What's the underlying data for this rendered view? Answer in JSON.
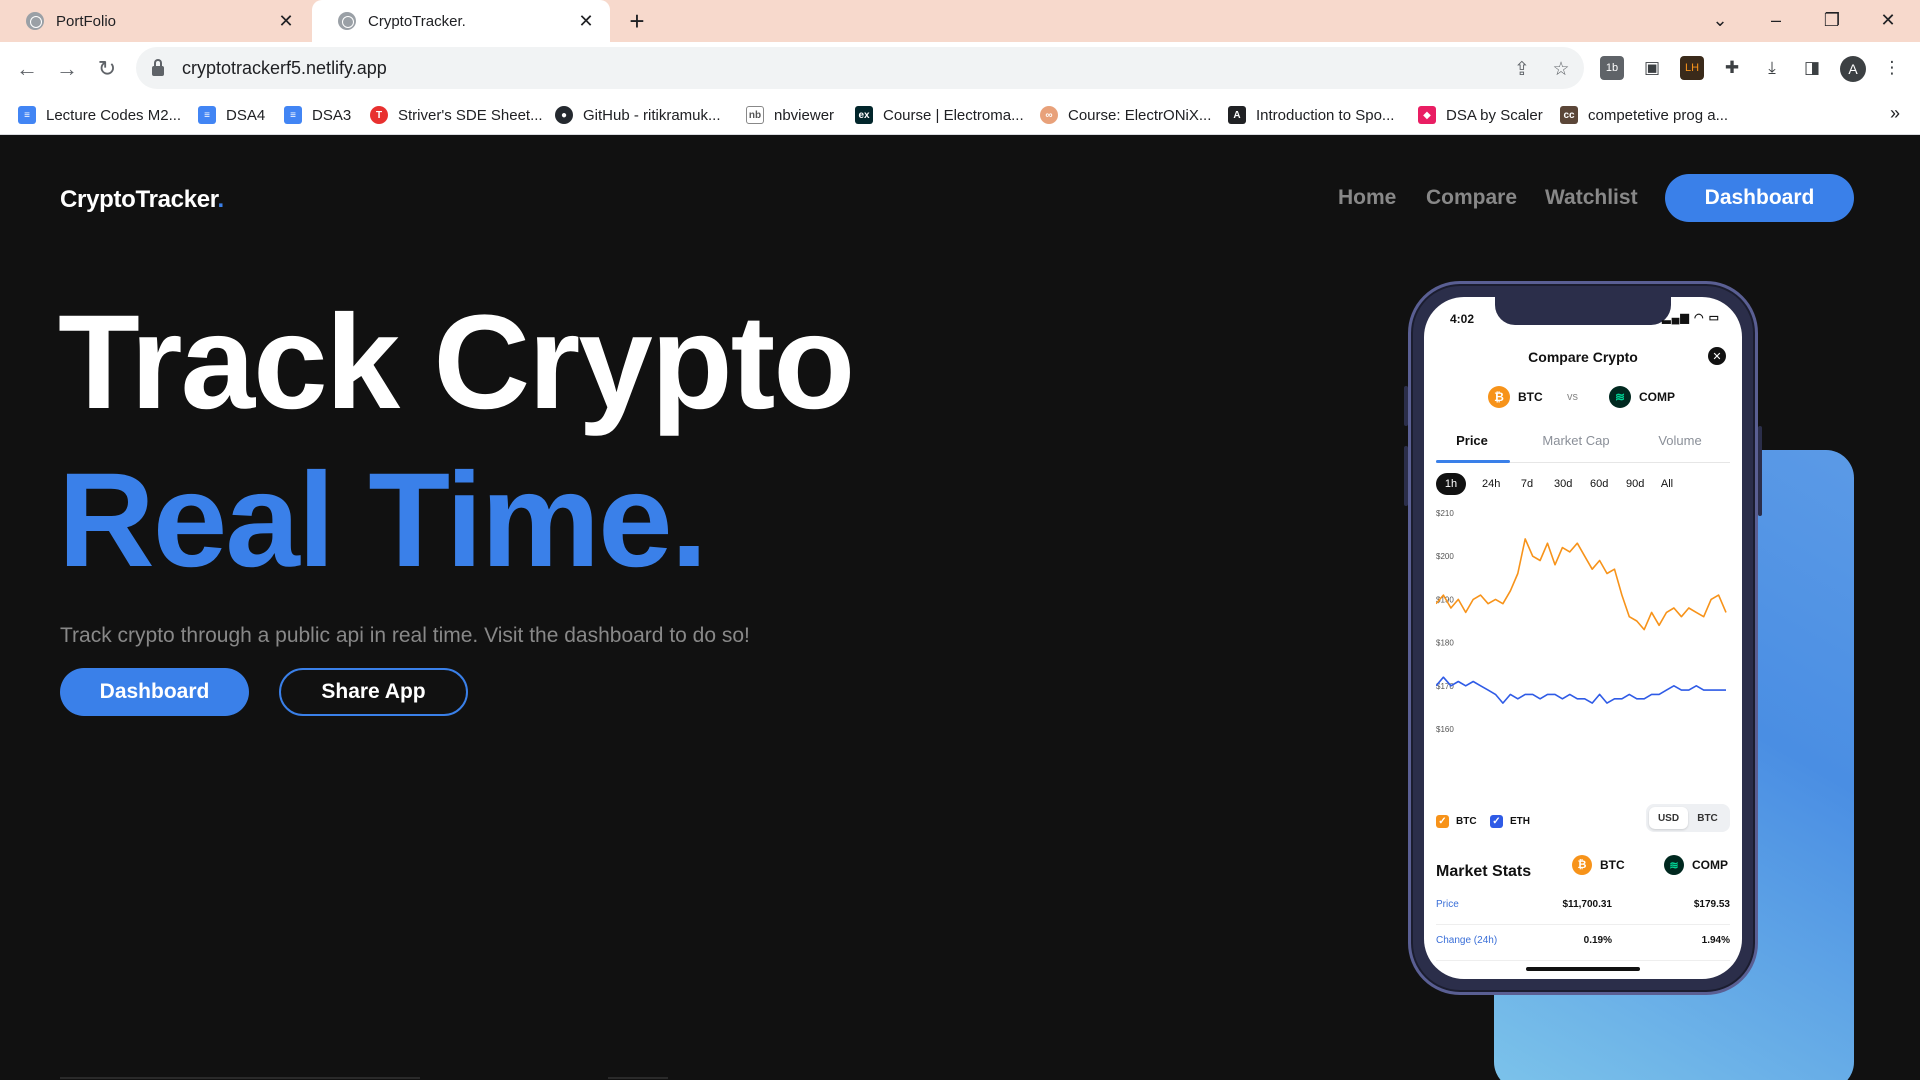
{
  "browser": {
    "tabs": [
      {
        "title": "PortFolio",
        "active": false
      },
      {
        "title": "CryptoTracker.",
        "active": true
      }
    ],
    "url": "cryptotrackerf5.netlify.app",
    "profile_initial": "A",
    "bookmarks": [
      {
        "label": "Lecture Codes M2...",
        "icon": "doc-icon",
        "color": "#4285f4"
      },
      {
        "label": "DSA4",
        "icon": "doc-icon",
        "color": "#4285f4"
      },
      {
        "label": "DSA3",
        "icon": "doc-icon",
        "color": "#4285f4"
      },
      {
        "label": "Striver's SDE Sheet...",
        "icon": "tuf-icon",
        "color": "#e8302f"
      },
      {
        "label": "GitHub - ritikramuk...",
        "icon": "github-icon",
        "color": "#24292f"
      },
      {
        "label": "nbviewer",
        "icon": "nbviewer-icon",
        "color": "#f37726"
      },
      {
        "label": "Course | Electroma...",
        "icon": "edx-icon",
        "color": "#02262b"
      },
      {
        "label": "Course: ElectrONiX...",
        "icon": "course-icon",
        "color": "#e8a17a"
      },
      {
        "label": "Introduction to Spo...",
        "icon": "translate-icon",
        "color": "#202124"
      },
      {
        "label": "DSA by Scaler",
        "icon": "scaler-icon",
        "color": "#e91e63"
      },
      {
        "label": "competetive prog a...",
        "icon": "cc-icon",
        "color": "#5b4638"
      }
    ]
  },
  "site": {
    "logo": "CryptoTracker",
    "logo_dot": ".",
    "nav": [
      "Home",
      "Compare",
      "Watchlist"
    ],
    "nav_cta": "Dashboard",
    "hero_line1": "Track Crypto",
    "hero_line2": "Real Time.",
    "subtitle": "Track crypto through a public api in real time. Visit the dashboard to do so!",
    "cta_primary": "Dashboard",
    "cta_secondary": "Share App",
    "accent": "#3a80e9"
  },
  "phone": {
    "time": "4:02",
    "title": "Compare Crypto",
    "coin_a": "BTC",
    "vs": "vs",
    "coin_b": "COMP",
    "tabs": [
      "Price",
      "Market Cap",
      "Volume"
    ],
    "ranges": [
      "1h",
      "24h",
      "7d",
      "30d",
      "60d",
      "90d",
      "All"
    ],
    "active_range": "1h",
    "legend": [
      "BTC",
      "ETH"
    ],
    "currency_toggle": [
      "USD",
      "BTC"
    ],
    "stats_title": "Market Stats",
    "stats": [
      {
        "label": "Price",
        "btc": "$11,700.31",
        "comp": "$179.53"
      },
      {
        "label": "Change (24h)",
        "btc": "0.19%",
        "comp": "1.94%"
      }
    ]
  },
  "chart_data": {
    "type": "line",
    "yticks": [
      "$210",
      "$200",
      "$190",
      "$180",
      "$170",
      "$160"
    ],
    "ylim": [
      160,
      210
    ],
    "series": [
      {
        "name": "BTC",
        "color": "#f7931a",
        "values": [
          189,
          191,
          188,
          190,
          187,
          190,
          191,
          189,
          190,
          189,
          192,
          196,
          204,
          200,
          199,
          203,
          198,
          202,
          201,
          203,
          200,
          197,
          199,
          196,
          197,
          191,
          186,
          185,
          183,
          187,
          184,
          187,
          188,
          186,
          188,
          187,
          186,
          190,
          191,
          187
        ]
      },
      {
        "name": "ETH",
        "color": "#2f5be6",
        "values": [
          170,
          172,
          170,
          171,
          170,
          171,
          170,
          169,
          168,
          166,
          168,
          167,
          168,
          168,
          167,
          168,
          168,
          167,
          168,
          167,
          167,
          166,
          168,
          166,
          167,
          167,
          168,
          167,
          167,
          168,
          168,
          169,
          170,
          169,
          169,
          170,
          169,
          169,
          169,
          169
        ]
      }
    ]
  }
}
